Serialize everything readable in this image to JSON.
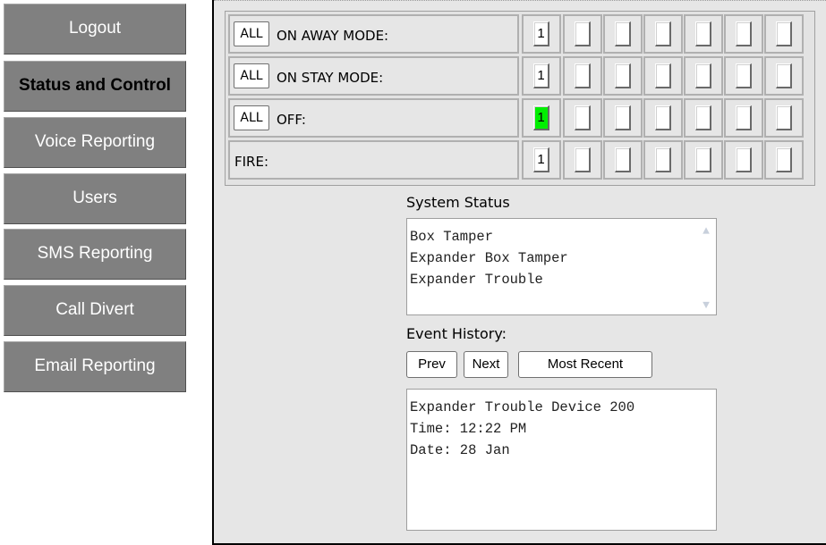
{
  "sidebar": {
    "items": [
      {
        "label": "Logout"
      },
      {
        "label": "Status and Control"
      },
      {
        "label": "Voice Reporting"
      },
      {
        "label": "Users"
      },
      {
        "label": "SMS Reporting"
      },
      {
        "label": "Call Divert"
      },
      {
        "label": "Email Reporting"
      }
    ]
  },
  "zones": {
    "all_label": "ALL",
    "rows": [
      {
        "label": "ON AWAY MODE:",
        "value": "1"
      },
      {
        "label": "ON STAY MODE:",
        "value": "1"
      },
      {
        "label": "OFF:",
        "value": "1",
        "highlight": "#00ee00"
      },
      {
        "label": "FIRE:",
        "value": "1"
      }
    ]
  },
  "system_status": {
    "title": "System Status",
    "lines": [
      "Box Tamper",
      "Expander Box Tamper",
      "Expander Trouble"
    ]
  },
  "event_history": {
    "title": "Event History:",
    "prev_label": "Prev",
    "next_label": "Next",
    "recent_label": "Most Recent",
    "lines": [
      "Expander Trouble Device 200",
      "Time: 12:22 PM",
      "Date: 28 Jan"
    ]
  }
}
